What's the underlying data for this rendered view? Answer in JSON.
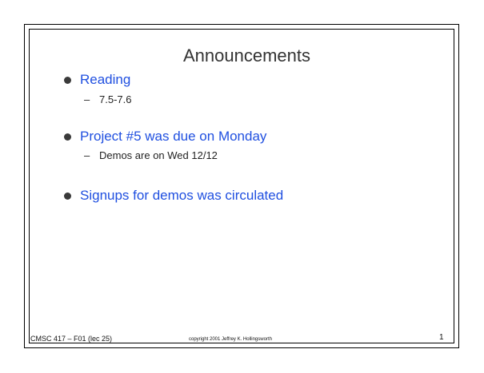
{
  "slide": {
    "title": "Announcements",
    "bullets": [
      {
        "text": "Reading",
        "sub": "7.5-7.6"
      },
      {
        "text": "Project #5 was due on Monday",
        "sub": "Demos are on Wed 12/12"
      },
      {
        "text": "Signups for demos was circulated"
      }
    ],
    "sub_dash": "–",
    "footer": {
      "course": "CMSC 417 – F01  (lec 25)",
      "copyright": "copyright 2001  Jeffrey K. Hollingsworth",
      "page_number": "1"
    }
  }
}
